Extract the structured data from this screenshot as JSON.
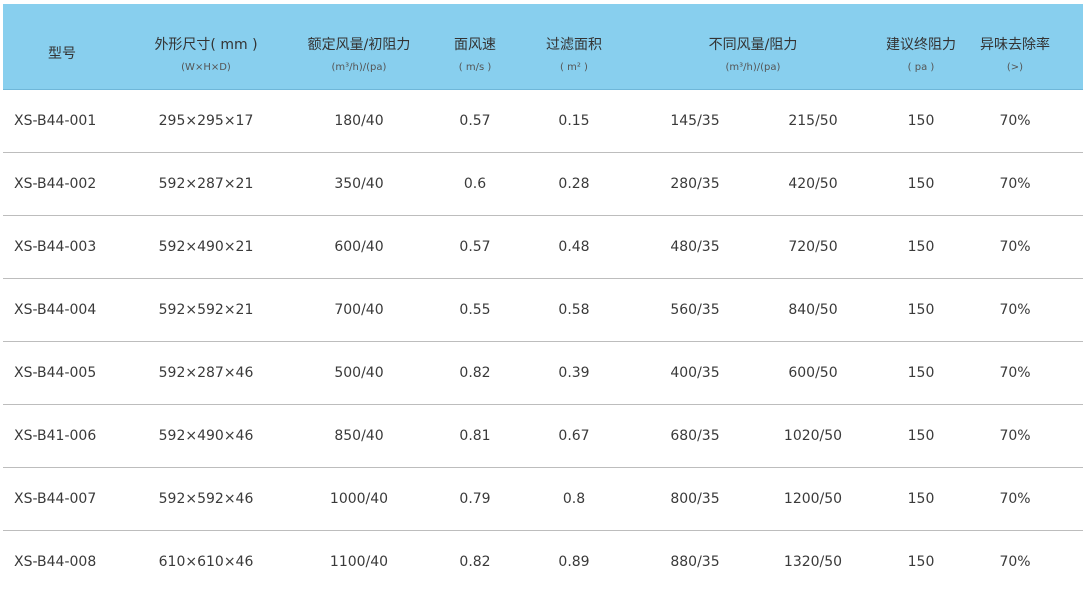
{
  "header": {
    "model": "型号",
    "size": "外形尺寸( mm )",
    "size_sub": "(W×H×D)",
    "rated": "额定风量/初阻力",
    "rated_sub": "(m³/h)/(pa)",
    "velocity": "面风速",
    "velocity_sub": "( m/s )",
    "area": "过滤面积",
    "area_sub": "( m² )",
    "diff": "不同风量/阻力",
    "diff_sub": "(m³/h)/(pa)",
    "final": "建议终阻力",
    "final_sub": "( pa )",
    "odor": "异味去除率",
    "odor_sub": "(>)"
  },
  "rows": [
    {
      "model": "XS-B44-001",
      "size": "295×295×17",
      "rated": "180/40",
      "velocity": "0.57",
      "area": "0.15",
      "flow1": "145/35",
      "flow2": "215/50",
      "final": "150",
      "odor": "70%"
    },
    {
      "model": "XS-B44-002",
      "size": "592×287×21",
      "rated": "350/40",
      "velocity": "0.6",
      "area": "0.28",
      "flow1": "280/35",
      "flow2": "420/50",
      "final": "150",
      "odor": "70%"
    },
    {
      "model": "XS-B44-003",
      "size": "592×490×21",
      "rated": "600/40",
      "velocity": "0.57",
      "area": "0.48",
      "flow1": "480/35",
      "flow2": "720/50",
      "final": "150",
      "odor": "70%"
    },
    {
      "model": "XS-B44-004",
      "size": "592×592×21",
      "rated": "700/40",
      "velocity": "0.55",
      "area": "0.58",
      "flow1": "560/35",
      "flow2": "840/50",
      "final": "150",
      "odor": "70%"
    },
    {
      "model": "XS-B44-005",
      "size": "592×287×46",
      "rated": "500/40",
      "velocity": "0.82",
      "area": "0.39",
      "flow1": "400/35",
      "flow2": "600/50",
      "final": "150",
      "odor": "70%"
    },
    {
      "model": "XS-B41-006",
      "size": "592×490×46",
      "rated": "850/40",
      "velocity": "0.81",
      "area": "0.67",
      "flow1": "680/35",
      "flow2": "1020/50",
      "final": "150",
      "odor": "70%"
    },
    {
      "model": "XS-B44-007",
      "size": "592×592×46",
      "rated": "1000/40",
      "velocity": "0.79",
      "area": "0.8",
      "flow1": "800/35",
      "flow2": "1200/50",
      "final": "150",
      "odor": "70%"
    },
    {
      "model": "XS-B44-008",
      "size": "610×610×46",
      "rated": "1100/40",
      "velocity": "0.82",
      "area": "0.89",
      "flow1": "880/35",
      "flow2": "1320/50",
      "final": "150",
      "odor": "70%"
    }
  ]
}
